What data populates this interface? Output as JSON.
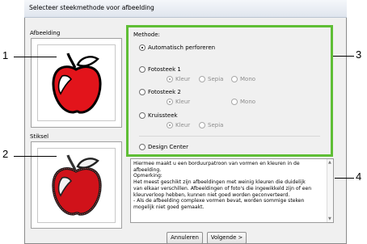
{
  "window": {
    "title": "Selecteer steekmethode voor afbeelding"
  },
  "left": {
    "image_label": "Afbeelding",
    "stitch_label": "Stiksel"
  },
  "method": {
    "group_label": "Methode:",
    "options": [
      {
        "label": "Automatisch perforeren",
        "selected": true
      },
      {
        "label": "Fotosteek 1",
        "selected": false
      },
      {
        "label": "Fotosteek 2",
        "selected": false
      },
      {
        "label": "Kruissteek",
        "selected": false
      },
      {
        "label": "Design Center",
        "selected": false
      }
    ],
    "fotosteek1_sub": [
      "Kleur",
      "Sepia",
      "Mono"
    ],
    "fotosteek2_sub": [
      "Kleur",
      "Mono"
    ],
    "kruissteek_sub": [
      "Kleur",
      "Sepia"
    ]
  },
  "description": {
    "lines": [
      "Hiermee maakt u een borduurpatroon van vormen en kleuren in de",
      "afbeelding.",
      "Opmerking:",
      "  Het meest geschikt zijn afbeeldingen met weinig kleuren die duidelijk",
      "van elkaar verschillen. Afbeeldingen of foto's die ingewikkeld zijn of een",
      "kleurverloop hebben, kunnen niet goed worden geconverteerd.",
      "- Als de afbeelding complexe vormen bevat, worden sommige steken",
      "mogelijk niet goed gemaakt."
    ]
  },
  "buttons": {
    "cancel": "Annuleren",
    "next": "Volgende >"
  },
  "callouts": [
    "1",
    "2",
    "3",
    "4"
  ],
  "colors": {
    "highlight": "#5fbe35",
    "apple_red": "#e2141b"
  }
}
